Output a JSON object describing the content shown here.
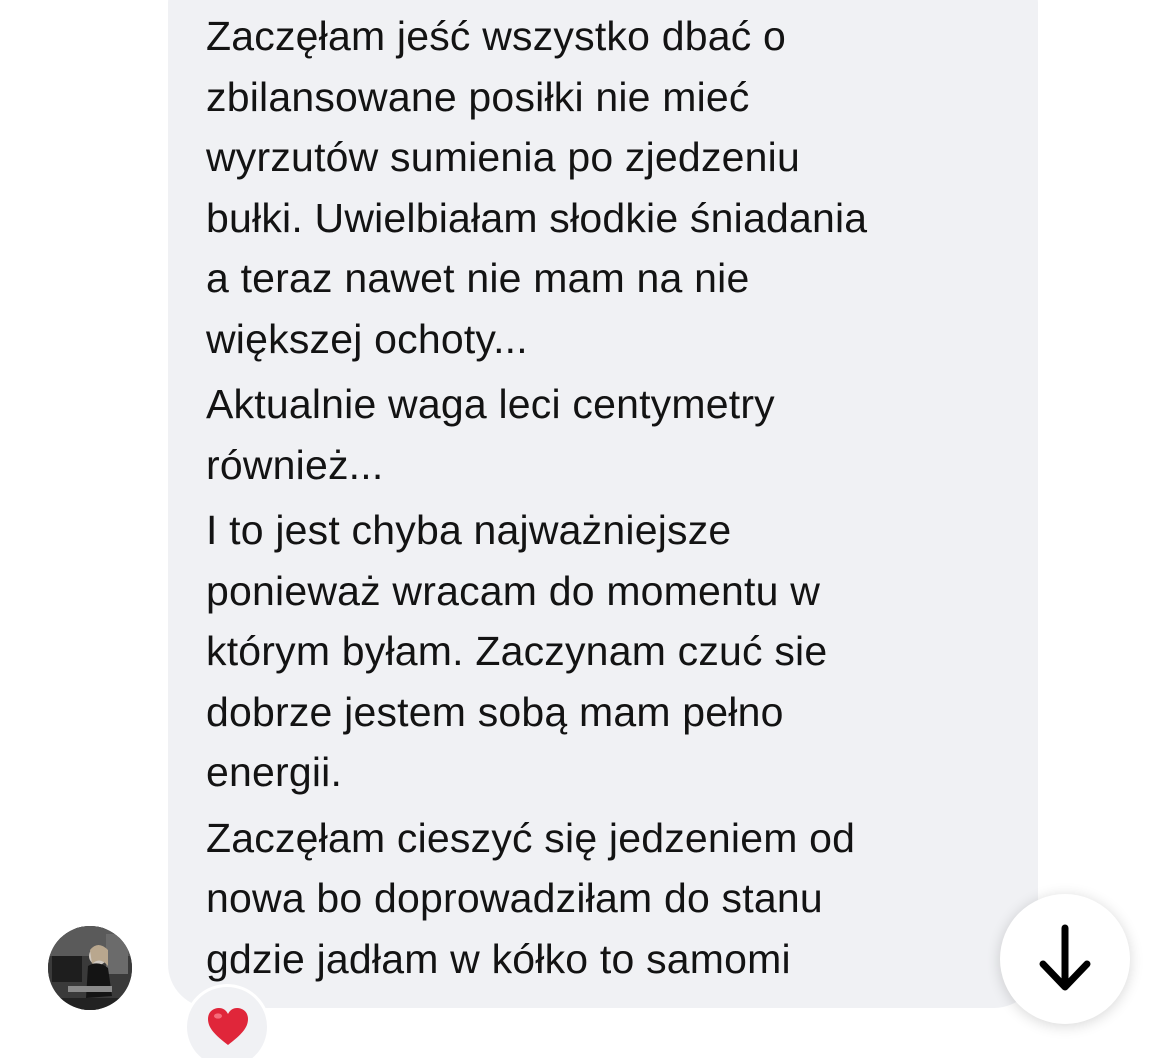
{
  "message": {
    "paragraphs": [
      {
        "lines": [
          "Zaczęłam jeść wszystko dbać o",
          "zbilansowane posiłki nie mieć",
          "wyrzutów sumienia po zjedzeniu",
          "bułki. Uwielbiałam słodkie śniadania",
          "a teraz nawet nie mam na nie",
          "większej ochoty..."
        ]
      },
      {
        "lines": [
          "Aktualnie waga leci centymetry",
          "również..."
        ]
      },
      {
        "lines": [
          "I to jest chyba najważniejsze",
          "ponieważ wracam do momentu w",
          "którym byłam. Zaczynam czuć sie",
          "dobrze jestem sobą mam pełno",
          "energii."
        ]
      },
      {
        "lines": [
          "Zaczęłam cieszyć się jedzeniem od",
          "nowa bo doprowadziłam do stanu",
          "gdzie jadłam w kółko to samomi"
        ]
      }
    ],
    "reaction_icon": "red-heart-icon",
    "reaction_color": "#e0263a"
  },
  "sender": {
    "avatar_icon": "profile-photo"
  },
  "controls": {
    "scroll_down_icon": "arrow-down-icon"
  },
  "colors": {
    "bubble_background": "#f0f1f4",
    "text": "#131313",
    "page_background": "#ffffff"
  }
}
